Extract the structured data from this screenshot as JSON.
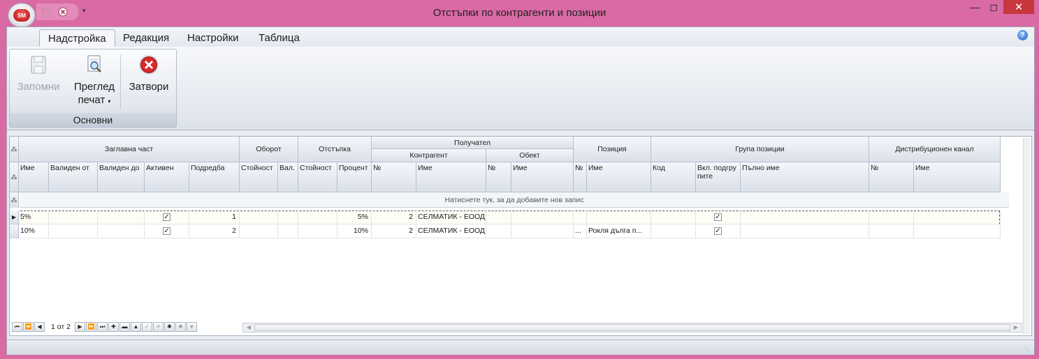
{
  "window": {
    "title": "Отстъпки по контрагенти и позиции",
    "app_logo": "SM"
  },
  "tabs": [
    {
      "label": "Надстройка",
      "active": true
    },
    {
      "label": "Редакция",
      "active": false
    },
    {
      "label": "Настройки",
      "active": false
    },
    {
      "label": "Таблица",
      "active": false
    }
  ],
  "ribbon": {
    "group_label": "Основни",
    "save_label": "Запомни",
    "preview_label_1": "Преглед",
    "preview_label_2": "печат",
    "close_label": "Затвори"
  },
  "grid": {
    "bands": {
      "header": "Заглавна част",
      "turnover": "Оборот",
      "discount": "Отстъпка",
      "recipient": "Получател",
      "counterparty": "Контрагент",
      "object": "Обект",
      "position": "Позиция",
      "position_group": "Група позиции",
      "channel": "Дистрибуционен канал"
    },
    "columns": [
      "Име",
      "Валиден от",
      "Валиден до",
      "Активен",
      "Подредба",
      "Стойност",
      "Вал.",
      "Стойност",
      "Процент",
      "№",
      "Име",
      "№",
      "Име",
      "№",
      "Име",
      "Код",
      "Вкл. подгрупите",
      "Пълно име",
      "№",
      "Име"
    ],
    "new_row_text": "Натиснете тук, за да добавите нов запис",
    "rows": [
      {
        "name": "5%",
        "active": true,
        "order": "1",
        "percent": "5%",
        "cp_no": "2",
        "cp_name": "СЕЛМАТИК - ЕООД",
        "pos_no": "",
        "pos_name": "",
        "include_sub": true,
        "selected": true
      },
      {
        "name": "10%",
        "active": true,
        "order": "2",
        "percent": "10%",
        "cp_no": "2",
        "cp_name": "СЕЛМАТИК - ЕООД",
        "pos_no": "...",
        "pos_name": "Рокля дълга п...",
        "include_sub": true,
        "selected": false
      }
    ]
  },
  "navigator": {
    "page_text": "1 от 2"
  }
}
